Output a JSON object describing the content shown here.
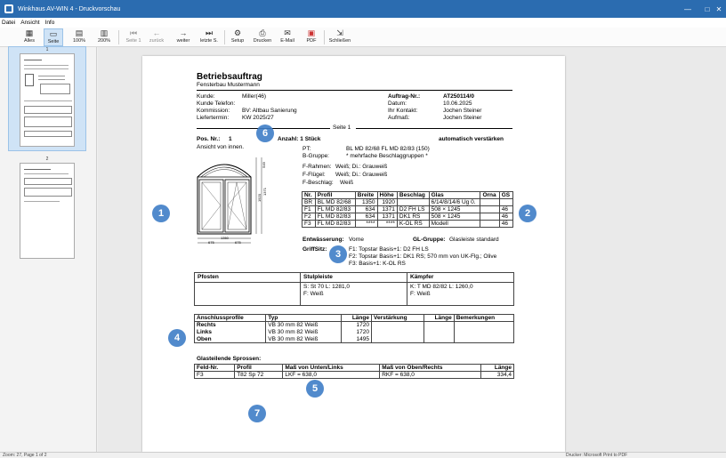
{
  "window": {
    "title": "Winkhaus AV-WIN 4 - Druckvorschau",
    "controls": {
      "minimize": "—",
      "maximize": "□",
      "close": "✕"
    }
  },
  "menu": [
    "Datei",
    "Ansicht",
    "Info"
  ],
  "toolbar": {
    "alles": "Alles",
    "seite": "Seite",
    "p100": "100%",
    "p200": "200%",
    "seite1": "Seite 1",
    "zurueck": "zurück",
    "weiter": "weiter",
    "letzte": "letzte S.",
    "setup": "Setup",
    "drucken": "Drucken",
    "email": "E-Mail",
    "pdf": "PDF",
    "schliessen": "Schließen"
  },
  "thumbs": {
    "page1": "1",
    "page2": "2"
  },
  "status": {
    "left": "Zoom: 27, Page 1 of 2",
    "right": "Drucker: Microsoft Print to PDF"
  },
  "doc": {
    "title": "Betriebsauftrag",
    "subtitle": "Fensterbau Mustermann",
    "kunde_l": "Kunde:",
    "kunde_v": "Miller(46)",
    "telefon_l": "Kunde Telefon:",
    "kommission_l": "Kommission:",
    "kommission_v": "BV: Altbau Sanierung",
    "liefertermin_l": "Liefertermin:",
    "liefertermin_v": "KW 2025/27",
    "auftrag_l": "Auftrag-Nr.:",
    "auftrag_v": "AT250114/0",
    "datum_l": "Datum:",
    "datum_v": "10.06.2025",
    "kontakt_l": "Ihr Kontakt:",
    "kontakt_v": "Jochen Steiner",
    "aufmass_l": "Aufmaß:",
    "aufmass_v": "Jochen Steiner",
    "seite": "Seite 1",
    "pos_l": "Pos. Nr.:",
    "pos_v": "1",
    "anzahl": "Anzahl: 1 Stück",
    "automatisch": "automatisch verstärken",
    "ansicht": "Ansicht von innen.",
    "pt_l": "PT:",
    "pt_v": "BL MD 82/68  FL MD 82/83 (150)",
    "bgruppe_l": "B-Gruppe:",
    "bgruppe_v": "* mehrfache Beschlaggruppen *",
    "frahmen_l": "F-Rahmen:",
    "frahmen_v": "Weiß; Di.: Grauweiß",
    "ffluegel_l": "F-Flügel:",
    "ffluegel_v": "Weiß; Di.: Grauweiß",
    "fbeschlag_l": "F-Beschlag:",
    "fbeschlag_v": "Weiß",
    "dims": {
      "h1": "1920",
      "h2": "1371",
      "h3": "549",
      "w_total": "1350",
      "w1": "675",
      "w2": "675"
    },
    "parts": {
      "headers": [
        "Nr.",
        "Profil",
        "Breite",
        "Höhe",
        "Beschlag",
        "Glas",
        "Orna",
        "GS"
      ],
      "rows": [
        [
          "BR",
          "BL MD 82/68",
          "1350",
          "1920",
          "",
          "6/14/8/14/6 Ug 0.",
          "",
          ""
        ],
        [
          "F1",
          "FL MD 82/83",
          "634",
          "1371",
          "D2 FH LS",
          "508 × 1245",
          "",
          "46"
        ],
        [
          "F2",
          "FL MD 82/83",
          "634",
          "1371",
          "DK1 RS",
          "508 × 1245",
          "",
          "46"
        ],
        [
          "F3",
          "FL MD 82/83",
          "****",
          "****",
          "K-OL RS",
          "Modell",
          "",
          "46"
        ]
      ]
    },
    "entwaesserung_l": "Entwässerung:",
    "entwaesserung_v": "Vorne",
    "glgruppe_l": "GL-Gruppe:",
    "glgruppe_v": "Glasleiste standard",
    "griffsitz_l": "GriffSitz:",
    "griffsitz_lines": [
      "F1: Topstar Basis+1: D2 FH LS",
      "F2: Topstar Basis+1: DK1 RS; 570 mm von UK-Flg.; Olive",
      "F3: Basis+1: K-OL RS"
    ],
    "pfosten_l": "Pfosten",
    "stulp_l": "Stulpleiste",
    "stulp_v1": "S: St 70 L: 1281,0",
    "stulp_v2": "F: Weiß",
    "kaempfer_l": "Kämpfer",
    "kaempfer_v1": "K: T MD 82/82 L: 1260,0",
    "kaempfer_v2": "F: Weiß",
    "anschluss": {
      "headers": [
        "Anschlussprofile",
        "Typ",
        "Länge",
        "Verstärkung",
        "Länge",
        "Bemerkungen"
      ],
      "rows": [
        [
          "Rechts",
          "VB 30 mm 82 Weiß",
          "1720",
          "",
          "",
          ""
        ],
        [
          "Links",
          "VB 30 mm 82 Weiß",
          "1720",
          "",
          "",
          ""
        ],
        [
          "Oben",
          "VB 30 mm 82 Weiß",
          "1495",
          "",
          "",
          ""
        ]
      ]
    },
    "sprossen_title": "Glasteilende Sprossen:",
    "sprossen": {
      "headers": [
        "Feld-Nr.",
        "Profil",
        "Maß von Unten/Links",
        "Maß von Oben/Rechts",
        "Länge"
      ],
      "rows": [
        [
          "F3",
          "T82 Sp 72",
          "LKF = 638,0",
          "RKF = 638,0",
          "334,4"
        ]
      ]
    }
  },
  "badges": [
    "1",
    "2",
    "3",
    "4",
    "5",
    "6",
    "7"
  ],
  "colors": {
    "accent": "#2b6cb0",
    "badge": "#3f7ec7",
    "selection": "#cfe3f6"
  }
}
